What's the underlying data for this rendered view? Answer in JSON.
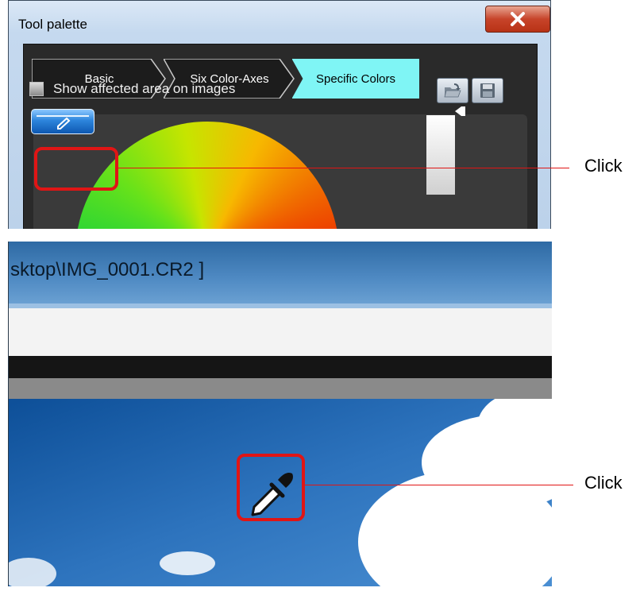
{
  "palette_window": {
    "title": "Tool palette",
    "close_icon": "close-x-icon",
    "tabs": [
      {
        "label": "Basic"
      },
      {
        "label": "Six Color-Axes"
      },
      {
        "label": "Specific Colors",
        "active": true
      }
    ],
    "toolbar_icons": [
      "folder-open-icon",
      "save-floppy-icon"
    ],
    "show_affected_label": "Show affected area on images",
    "show_affected_checked": false,
    "eyedropper_button_icon": "eyedropper-icon",
    "colors": {
      "active_tab": "#7ff5f5",
      "highlight": "#e01515",
      "button_blue": "#2d85dc"
    }
  },
  "image_window": {
    "title_text": "sktop\\IMG_0001.CR2 ]",
    "cursor_icon": "eyedropper-cursor-icon"
  },
  "callouts": [
    {
      "label": "Click"
    },
    {
      "label": "Click"
    }
  ]
}
